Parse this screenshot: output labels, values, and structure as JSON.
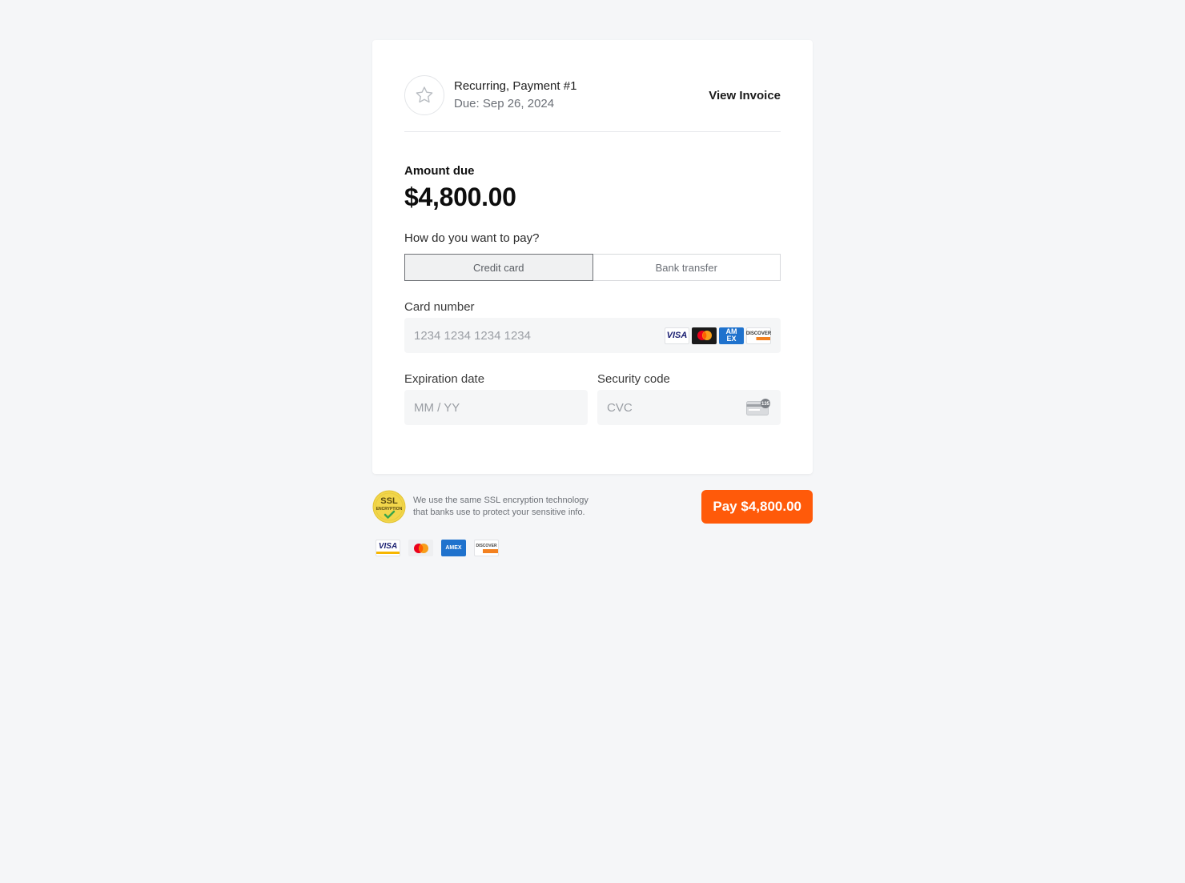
{
  "header": {
    "title": "Recurring, Payment #1",
    "due": "Due: Sep 26, 2024",
    "view_invoice": "View Invoice"
  },
  "amount": {
    "label": "Amount due",
    "value": "$4,800.00"
  },
  "payment_method": {
    "question": "How do you want to pay?",
    "options": [
      "Credit card",
      "Bank transfer"
    ],
    "selected": "Credit card"
  },
  "card": {
    "number_label": "Card number",
    "number_placeholder": "1234 1234 1234 1234",
    "expiry_label": "Expiration date",
    "expiry_placeholder": "MM / YY",
    "cvc_label": "Security code",
    "cvc_placeholder": "CVC",
    "cvc_icon_text": "135",
    "brands": [
      "visa-icon",
      "mastercard-icon",
      "amex-icon",
      "discover-icon"
    ]
  },
  "footer": {
    "ssl_badge_line1": "SSL",
    "ssl_badge_line2": "ENCRYPTION",
    "ssl_text_line1": "We use the same SSL encryption technology",
    "ssl_text_line2": "that banks use to protect your sensitive info.",
    "pay_button": "Pay $4,800.00"
  },
  "brand_labels": {
    "visa": "VISA",
    "amex": "AMEX",
    "discover": "DISCOVER"
  },
  "colors": {
    "accent": "#ff5a0a",
    "background": "#f5f6f8",
    "visa_blue": "#1a1f71",
    "amex_blue": "#1f72cd",
    "discover_orange": "#f38120"
  }
}
